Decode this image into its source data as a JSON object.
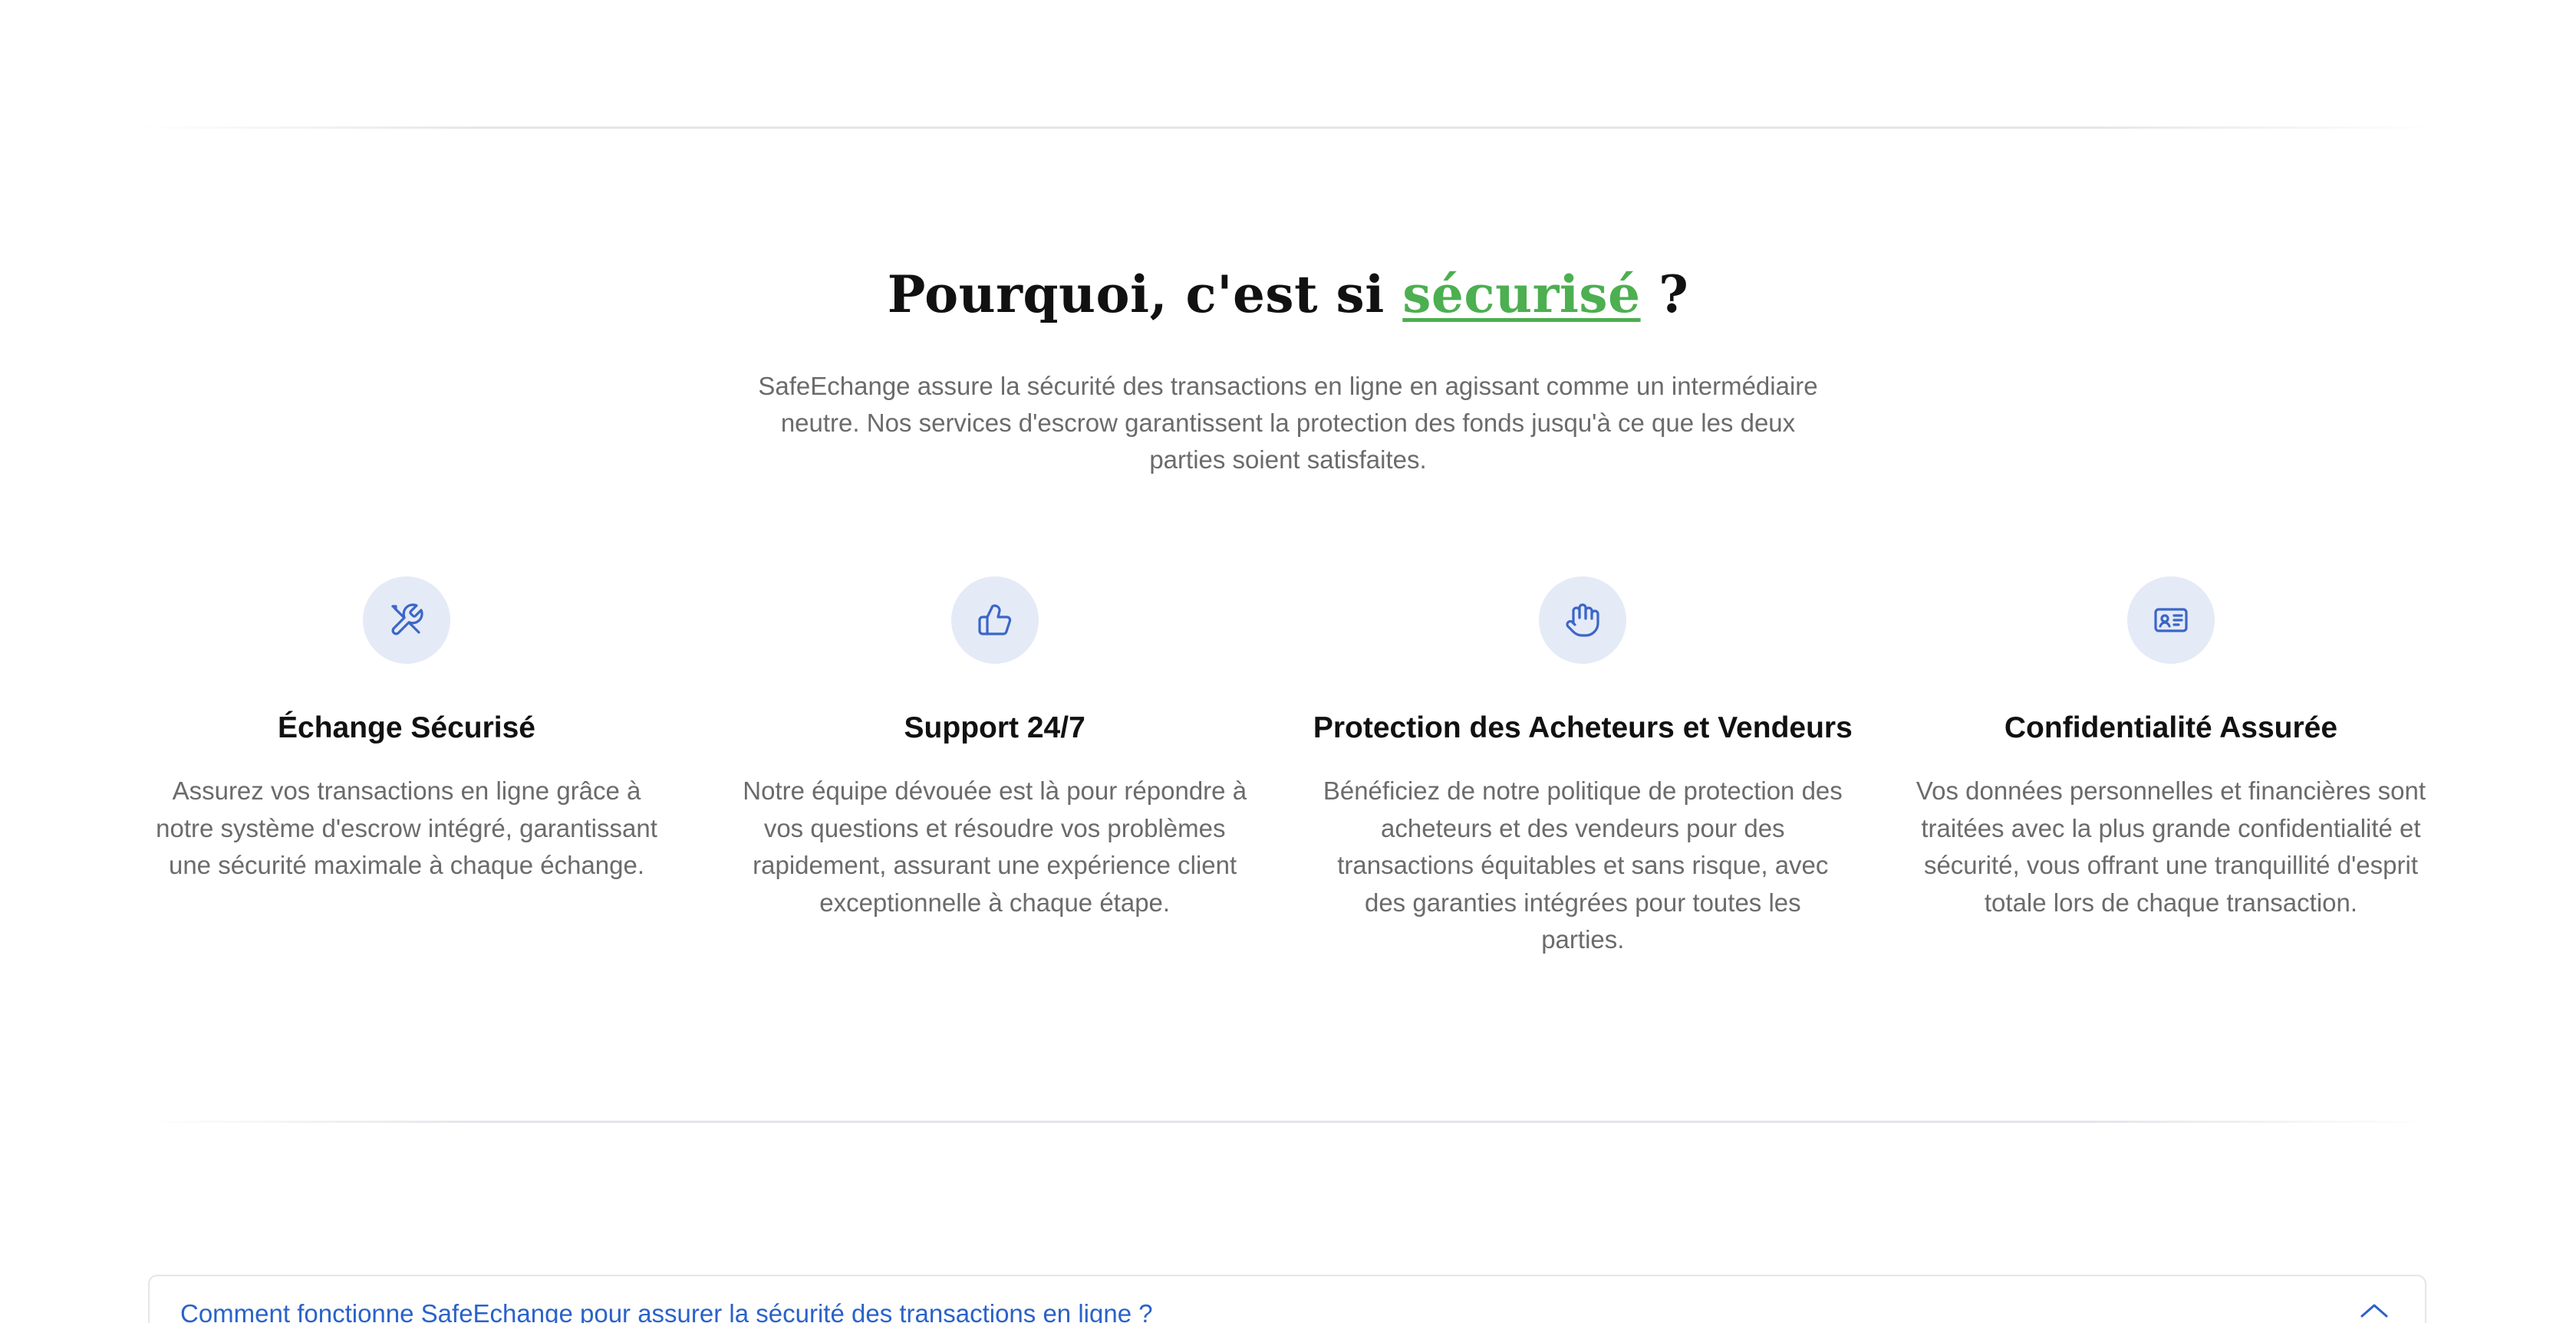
{
  "section": {
    "title_prefix": "Pourquoi, c'est si ",
    "title_highlight": "sécurisé",
    "title_suffix": " ?",
    "intro": "SafeEchange assure la sécurité des transactions en ligne en agissant comme un intermédiaire neutre. Nos services d'escrow garantissent la protection des fonds jusqu'à ce que les deux parties soient satisfaites.",
    "accent_color": "#4caf50",
    "icon_color": "#3b66c7",
    "icon_background": "#e5eaf7"
  },
  "features": [
    {
      "icon": "tools-icon",
      "title": "Échange Sécurisé",
      "text": "Assurez vos transactions en ligne grâce à notre système d'escrow intégré, garantissant une sécurité maximale à chaque échange."
    },
    {
      "icon": "thumbs-up-icon",
      "title": "Support 24/7",
      "text": "Notre équipe dévouée est là pour répondre à vos questions et résoudre vos problèmes rapidement, assurant une expérience client exceptionnelle à chaque étape."
    },
    {
      "icon": "hand-icon",
      "title": "Protection des Acheteurs et Vendeurs",
      "text": "Bénéficiez de notre politique de protection des acheteurs et des vendeurs pour des transactions équitables et sans risque, avec des garanties intégrées pour toutes les parties."
    },
    {
      "icon": "id-card-icon",
      "title": "Confidentialité Assurée",
      "text": "Vos données personnelles et financières sont traitées avec la plus grande confidentialité et sécurité, vous offrant une tranquillité d'esprit totale lors de chaque transaction."
    }
  ],
  "faq": {
    "question": "Comment fonctionne SafeEchange pour assurer la sécurité des transactions en ligne ?",
    "expanded": true,
    "link_color": "#2a62c9"
  }
}
